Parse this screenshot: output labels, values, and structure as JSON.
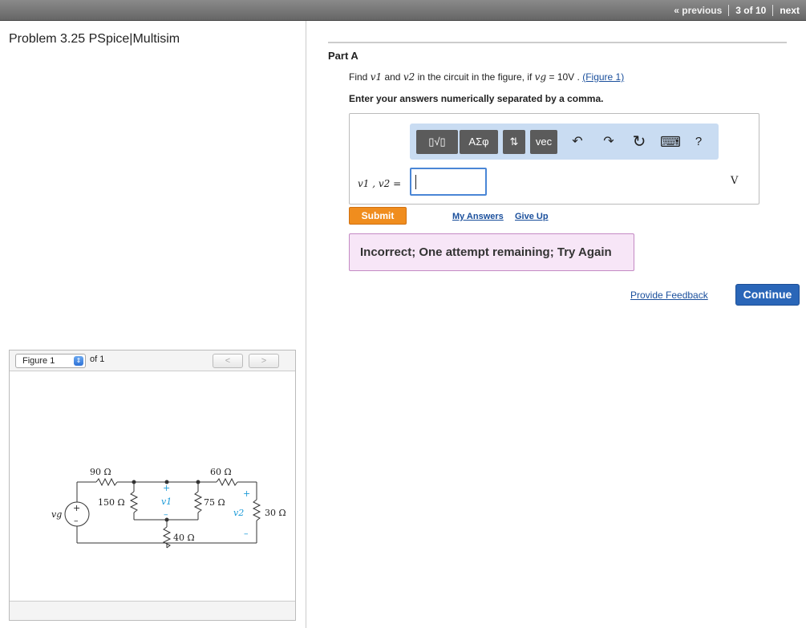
{
  "nav": {
    "previous": "« previous",
    "position": "3 of 10",
    "next": "next"
  },
  "problem": {
    "title": "Problem 3.25 PSpice|Multisim"
  },
  "figure": {
    "selector_value": "Figure 1",
    "of_label": "of 1",
    "prev_btn": "<",
    "next_btn": ">",
    "circuit": {
      "r90": "90 Ω",
      "r60": "60 Ω",
      "r150": "150 Ω",
      "r75": "75 Ω",
      "r40": "40 Ω",
      "r30": "30 Ω",
      "v1": "v1",
      "v2": "v2",
      "vg": "vg",
      "plus": "+",
      "minus": "–"
    }
  },
  "part": {
    "title": "Part A",
    "question_find": "Find",
    "v1": "v1",
    "and": "and",
    "v2": "v2",
    "in_circuit": "in the circuit in the figure, if",
    "vg": "vg",
    "equals": "= 10V .",
    "figure_link": "(Figure 1)",
    "instruction": "Enter your answers numerically separated by a comma."
  },
  "toolbar": {
    "templates": "▯√▯",
    "symbols": "ΑΣφ",
    "updown": "⇅",
    "vec": "vec",
    "undo_icon": "↶",
    "redo_icon": "↷",
    "reset_icon": "↻",
    "keyboard_icon": "⌨",
    "help": "?"
  },
  "answer": {
    "label": "v1 , v2 =",
    "value": "",
    "unit": "V"
  },
  "actions": {
    "submit": "Submit",
    "my_answers": "My Answers",
    "give_up": "Give Up"
  },
  "feedback": {
    "message": "Incorrect; One attempt remaining; Try Again"
  },
  "footer": {
    "provide_feedback": "Provide Feedback",
    "continue": "Continue"
  }
}
